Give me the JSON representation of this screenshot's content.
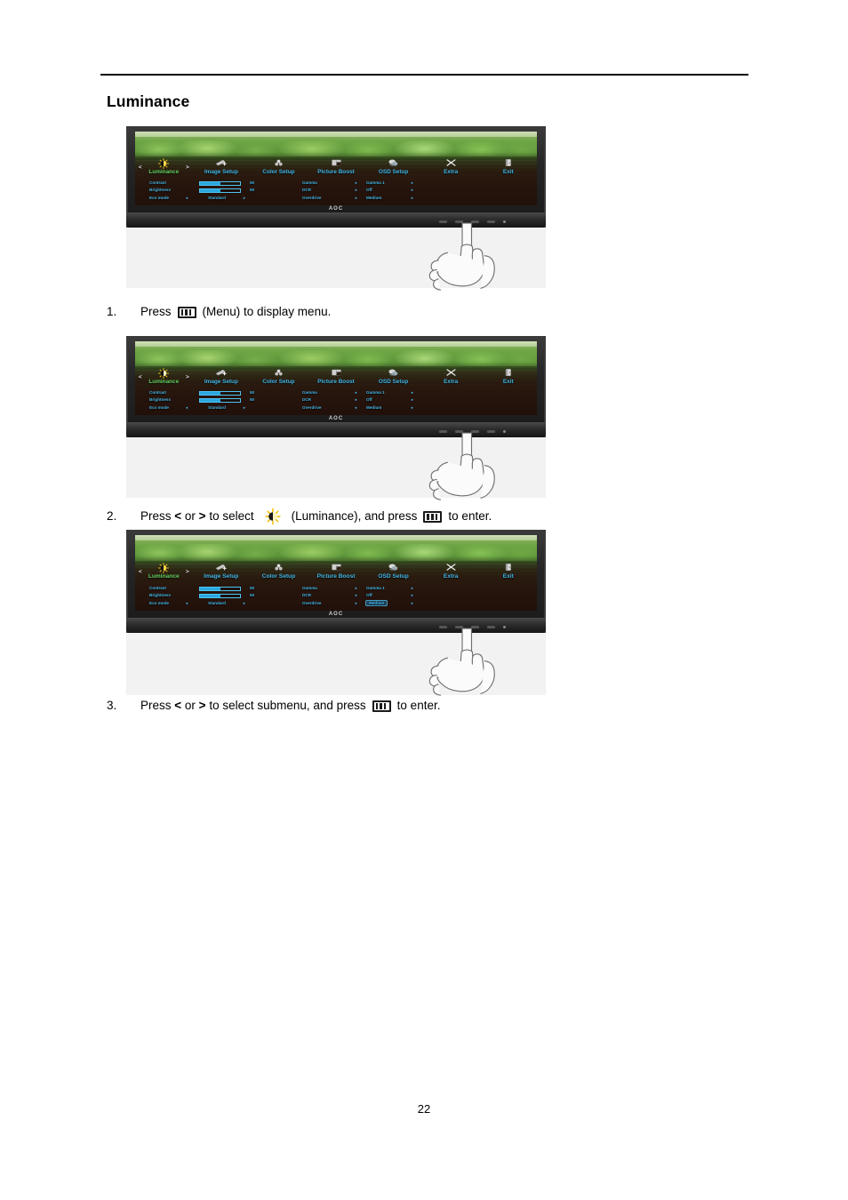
{
  "document": {
    "page_title": "Luminance",
    "page_number": "22"
  },
  "steps": [
    {
      "number": "1.",
      "text_before": "Press",
      "icon": "menu-button-icon",
      "text_after": "(Menu) to display menu."
    },
    {
      "number": "2.",
      "text_before": "Press < or > to select",
      "icon": "luminance-sun-icon",
      "text_after": "(Luminance), and press",
      "icon2": "menu-button-icon",
      "text_end": "to enter."
    },
    {
      "number": "3.",
      "text_before": "Press < or > to select submenu, and press",
      "icon": "menu-button-icon",
      "text_after": "to enter."
    }
  ],
  "osd": {
    "brand": "AOC",
    "nav_left": "<",
    "nav_right": ">",
    "tabs": [
      {
        "label": "Luminance",
        "icon": "sun-icon",
        "active": true
      },
      {
        "label": "Image Setup",
        "icon": "image-setup-icon",
        "active": false
      },
      {
        "label": "Color Setup",
        "icon": "color-setup-icon",
        "active": false
      },
      {
        "label": "Picture Boost",
        "icon": "picture-boost-icon",
        "active": false
      },
      {
        "label": "OSD Setup",
        "icon": "osd-setup-icon",
        "active": false
      },
      {
        "label": "Extra",
        "icon": "extra-icon",
        "active": false
      },
      {
        "label": "Exit",
        "icon": "exit-icon",
        "active": false
      }
    ],
    "left_items": [
      {
        "label": "Contrast",
        "type": "slider",
        "value": "50",
        "fill_percent": 50
      },
      {
        "label": "Brightness",
        "type": "slider",
        "value": "50",
        "fill_percent": 50
      },
      {
        "label": "Eco mode",
        "type": "option",
        "value": "Standard",
        "left_arrow": "◄",
        "right_arrow": "►"
      }
    ],
    "right_items": [
      {
        "label": "Gamma",
        "value": "Gamma 1",
        "left_arrow": "◄",
        "right_arrow": "►",
        "highlight": false
      },
      {
        "label": "DCR",
        "value": "Off",
        "left_arrow": "◄",
        "right_arrow": "►",
        "highlight": false
      },
      {
        "label": "Overdrive",
        "value": "Medium",
        "left_arrow": "◄",
        "right_arrow": "►",
        "highlight": false
      }
    ]
  },
  "colors": {
    "osd_text": "#3fb6e8",
    "osd_active": "#5fd25f",
    "slider_fill": "#2aa7df",
    "figure_bg": "#f2f2f2"
  },
  "figures": [
    {
      "name": "osd-screenshot-1"
    },
    {
      "name": "osd-screenshot-2"
    },
    {
      "name": "osd-screenshot-3"
    }
  ]
}
